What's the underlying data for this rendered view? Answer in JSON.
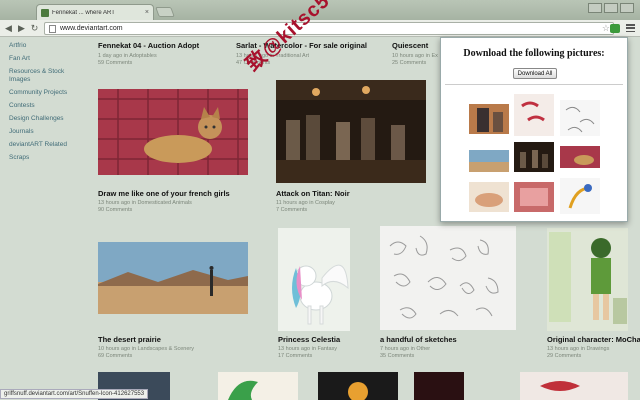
{
  "browser": {
    "tab_title": "Fennekat ... where ART",
    "tab_close": "×",
    "url": "www.deviantart.com"
  },
  "sidebar": {
    "items": [
      {
        "label": "Artfrio"
      },
      {
        "label": "Fan Art"
      },
      {
        "label": "Resources & Stock Images"
      },
      {
        "label": "Community Projects"
      },
      {
        "label": "Contests"
      },
      {
        "label": "Design Challenges"
      },
      {
        "label": "Journals"
      },
      {
        "label": "deviantART Related"
      },
      {
        "label": "Scraps"
      }
    ]
  },
  "top_row": [
    {
      "title": "Fennekat 04 - Auction Adopt",
      "meta": "1 day ago in Adoptables",
      "comments": "59 Comments"
    },
    {
      "title": "Sarlat - Watercolor - For sale original",
      "meta": "13 hours ago in Traditional Art",
      "comments": "47 Comments"
    },
    {
      "title": "Quiescent",
      "meta": "10 hours ago in Ex",
      "comments": "25 Comments"
    }
  ],
  "row2": [
    {
      "title": "Draw me like one of your french girls",
      "meta": "13 hours ago in Domesticated Animals",
      "comments": "90 Comments"
    },
    {
      "title": "Attack on Titan: Noir",
      "meta": "11 hours ago in Cosplay",
      "comments": "7 Comments"
    }
  ],
  "row3": [
    {
      "title": "The desert prairie",
      "meta": "10 hours ago in Landscapes & Scenery",
      "comments": "69 Comments"
    },
    {
      "title": "Princess Celestia",
      "meta": "13 hours ago in Fantasy",
      "comments": "17 Comments"
    },
    {
      "title": "a handful of sketches",
      "meta": "7 hours ago in Other",
      "comments": "35 Comments"
    },
    {
      "title": "Original character: MoCha",
      "meta": "13 hours ago in Drawings",
      "comments": "29 Comments"
    }
  ],
  "watermark": "致@kitsc566",
  "popup": {
    "title": "Download the following pictures:",
    "button": "Download All"
  },
  "status": "griffsnuff.deviantart.com/art/Snuffen-Icon-412627553",
  "colors": {
    "accent_link": "#3f6b77",
    "watermark": "#a8122d"
  }
}
